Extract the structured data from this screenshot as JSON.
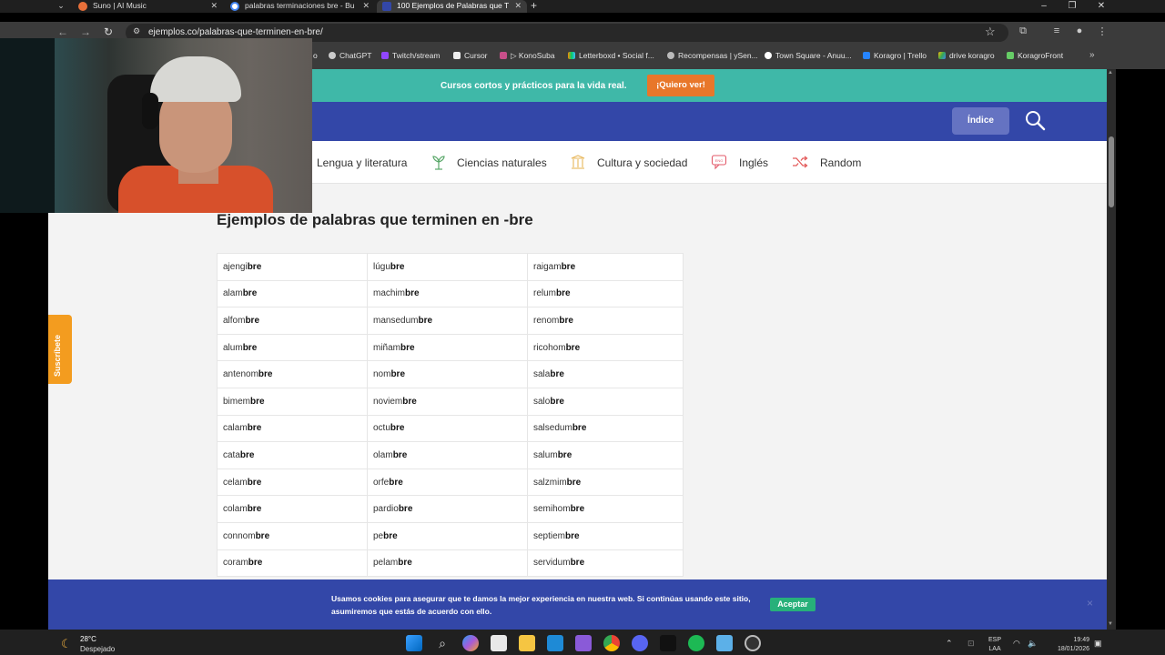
{
  "browser": {
    "tabs": [
      {
        "title": "Suno | AI Music",
        "active": false
      },
      {
        "title": "palabras terminaciones bre - Bu",
        "active": false
      },
      {
        "title": "100 Ejemplos de Palabras que T",
        "active": true
      }
    ],
    "url": "ejemplos.co/palabras-que-terminen-en-bre/",
    "bookmarks": [
      "o",
      "ChatGPT",
      "Twitch/stream",
      "Cursor",
      "▷ KonoSuba",
      "Letterboxd • Social f...",
      "Recompensas | ySen...",
      "Town Square - Anuu...",
      "Koragro | Trello",
      "drive koragro",
      "KoragroFront"
    ]
  },
  "promo": {
    "text": "Cursos cortos y prácticos para la vida real.",
    "button": "¡Quiero ver!"
  },
  "header": {
    "indice_label": "Índice"
  },
  "categories": [
    {
      "label": "Lengua y literatura",
      "icon": "book-icon"
    },
    {
      "label": "Ciencias naturales",
      "icon": "plant-icon"
    },
    {
      "label": "Cultura y sociedad",
      "icon": "columns-icon"
    },
    {
      "label": "Inglés",
      "icon": "speech-bubble-icon"
    },
    {
      "label": "Random",
      "icon": "shuffle-icon"
    }
  ],
  "article": {
    "title": "Ejemplos de palabras que terminen en -bre",
    "suffix": "bre",
    "rows": [
      [
        "ajengi",
        "lúgu",
        "raigam"
      ],
      [
        "alam",
        "machim",
        "relum"
      ],
      [
        "alfom",
        "mansedum",
        "renom"
      ],
      [
        "alum",
        "miñam",
        "ricohom"
      ],
      [
        "antenom",
        "nom",
        "sala"
      ],
      [
        "bimem",
        "noviem",
        "salo"
      ],
      [
        "calam",
        "octu",
        "salsedum"
      ],
      [
        "cata",
        "olam",
        "salum"
      ],
      [
        "celam",
        "orfe",
        "salzmim"
      ],
      [
        "colam",
        "pardio",
        "semihom"
      ],
      [
        "connom",
        "pe",
        "septiem"
      ],
      [
        "coram",
        "pelam",
        "servidum"
      ]
    ]
  },
  "subscribe_tab": "Suscríbete",
  "cookies": {
    "text": "Usamos cookies para asegurar que te damos la mejor experiencia en nuestra web. Si continúas usando este sitio, asumiremos que estás de acuerdo con ello.",
    "accept": "Aceptar",
    "close": "×"
  },
  "taskbar": {
    "temperature": "28°C",
    "weather": "Despejado",
    "lang_1": "ESP",
    "lang_2": "LAA",
    "time": "19:49",
    "date": "18/01/2026"
  }
}
